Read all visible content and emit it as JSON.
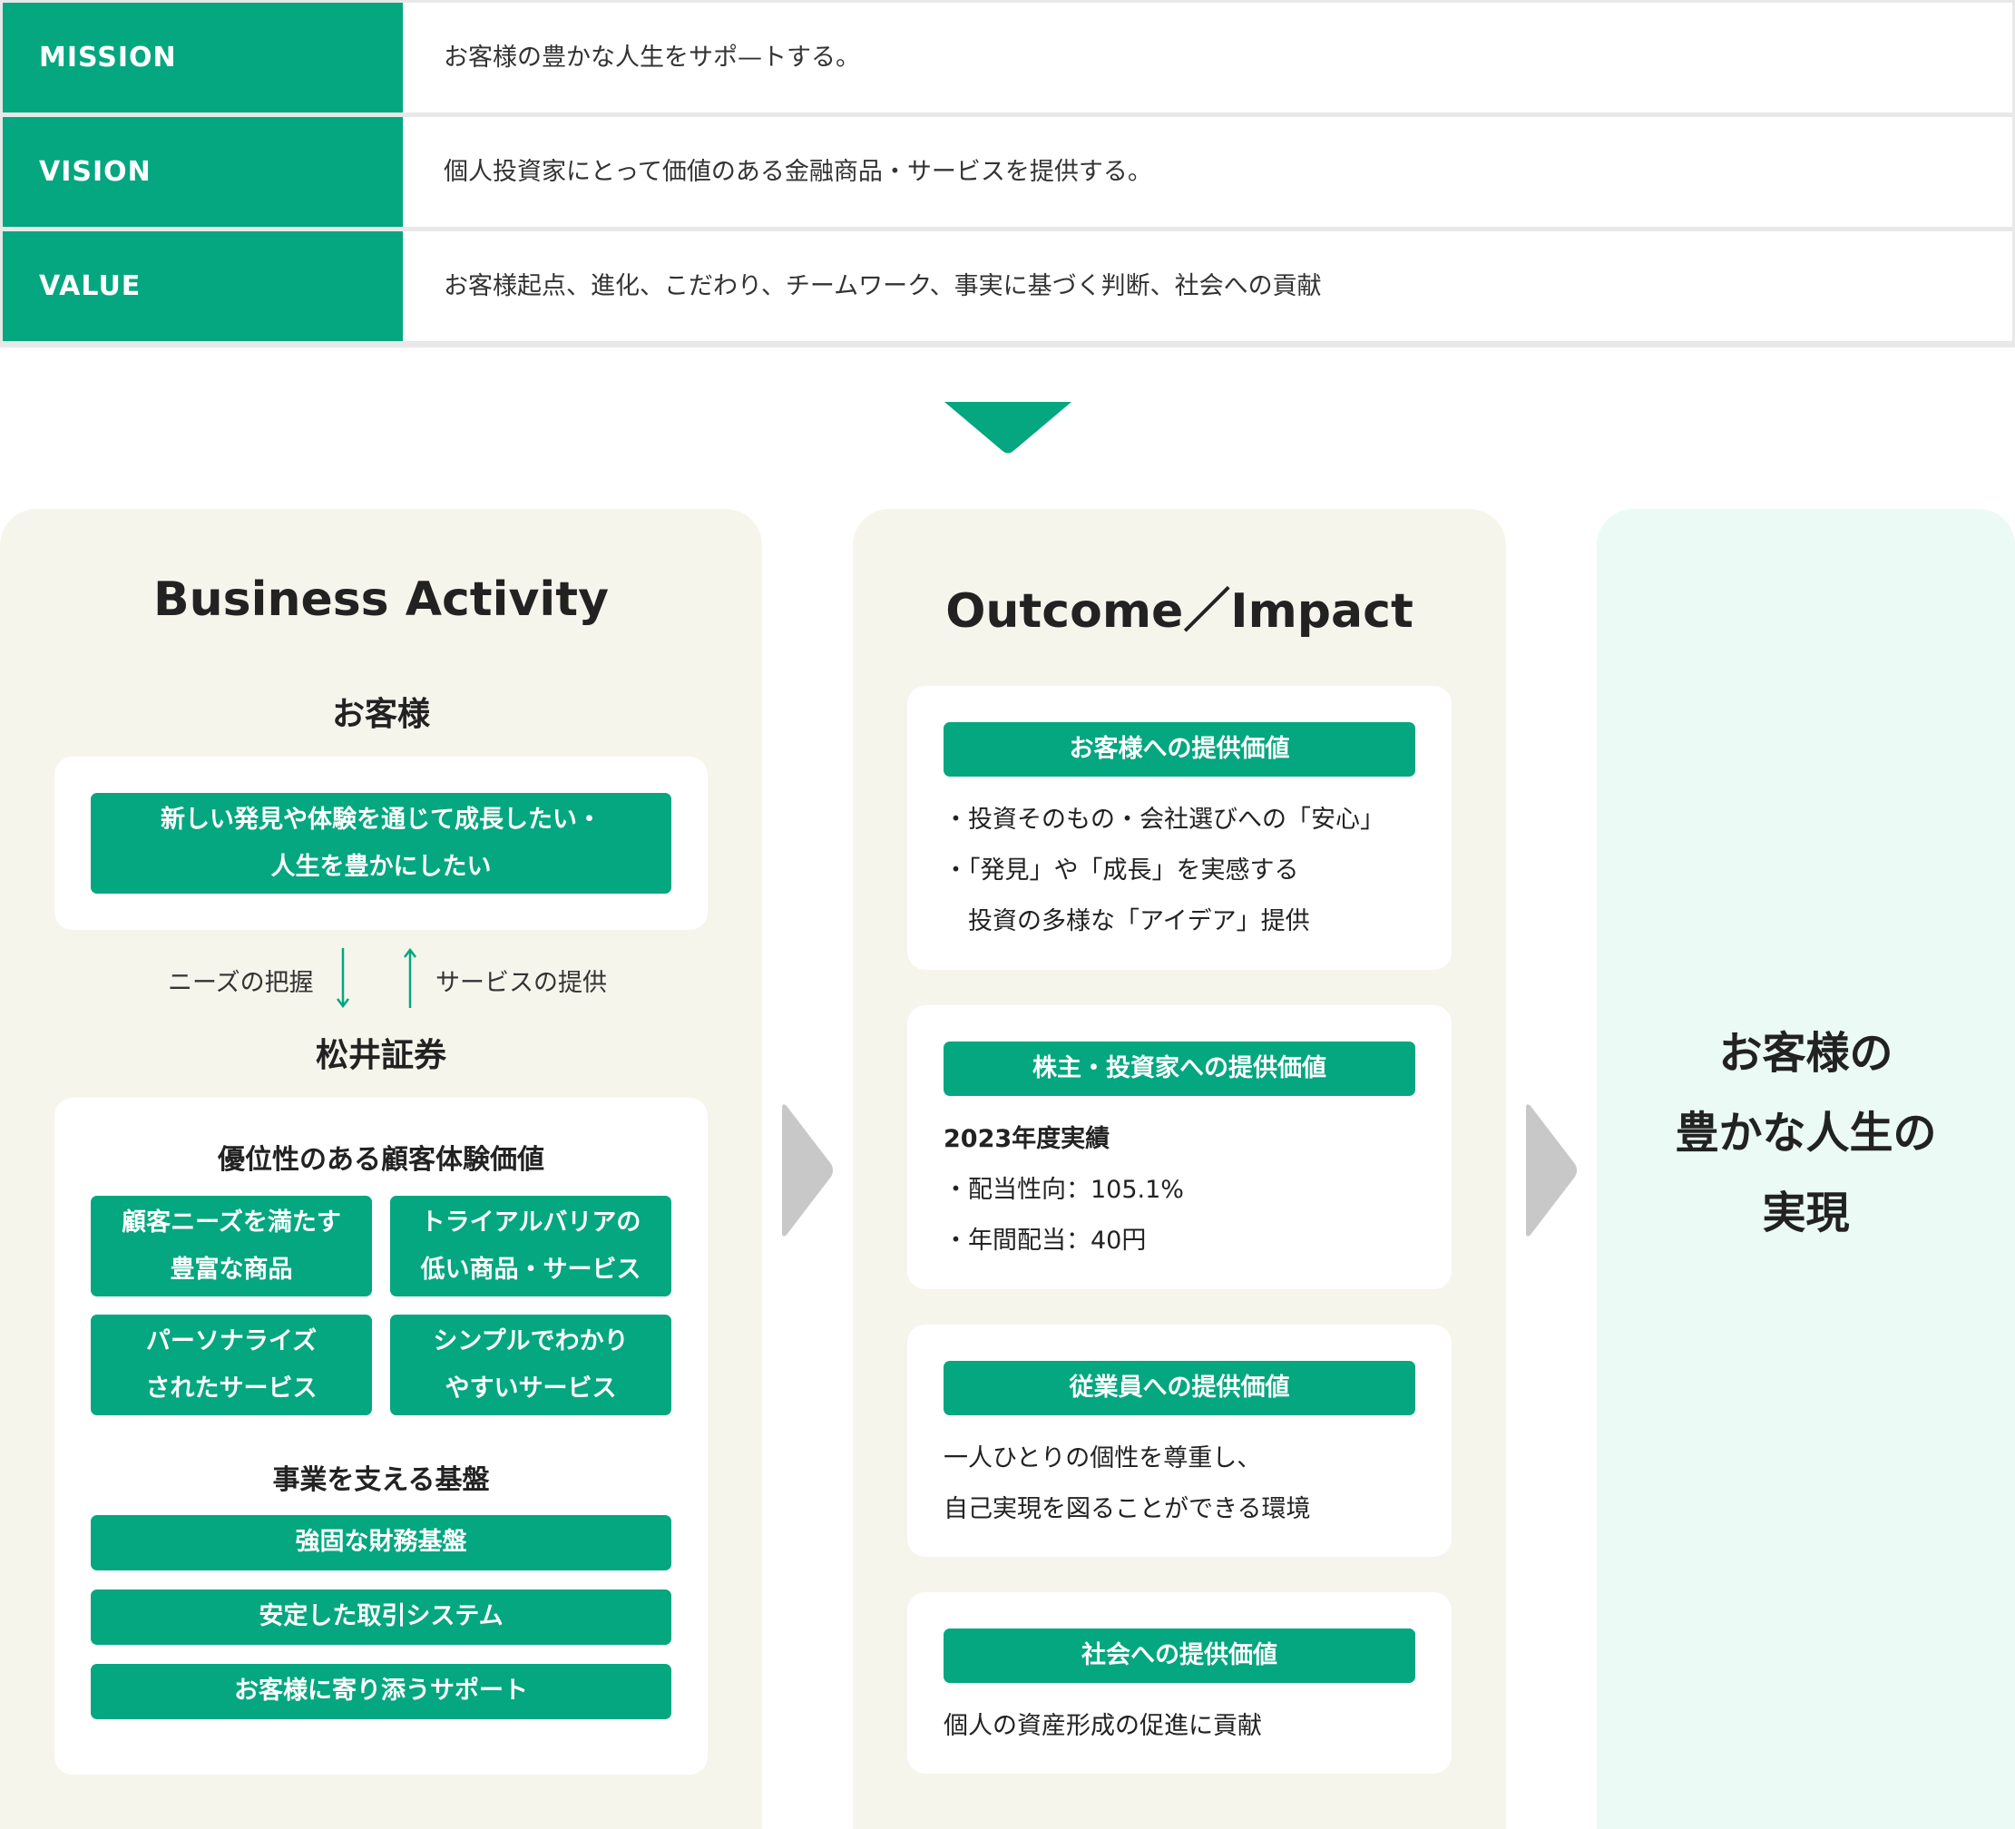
{
  "mvv": [
    {
      "label": "MISSION",
      "text": "お客様の豊かな人生をサポ—トする。"
    },
    {
      "label": "VISION",
      "text": "個人投資家にとって価値のある金融商品・サービスを提供する。"
    },
    {
      "label": "VALUE",
      "text": "お客様起点、進化、こだわり、チームワーク、事実に基づく判断、社会への貢献"
    }
  ],
  "business_activity": {
    "title": "Business Activity",
    "customer_title": "お客様",
    "customer_need": [
      "新しい発見や体験を通じて成長したい・",
      "人生を豊かにしたい"
    ],
    "flow_left": "ニーズの把握",
    "flow_right": "サービスの提供",
    "company_title": "松井証券",
    "experience_title": "優位性のある顧客体験価値",
    "experience_items": [
      [
        "顧客ニーズを満たす",
        "豊富な商品"
      ],
      [
        "トライアルバリアの",
        "低い商品・サービス"
      ],
      [
        "パーソナライズ",
        "されたサービス"
      ],
      [
        "シンプルでわかり",
        "やすいサービス"
      ]
    ],
    "foundation_title": "事業を支える基盤",
    "foundation_items": [
      "強固な財務基盤",
      "安定した取引システム",
      "お客様に寄り添うサポート"
    ]
  },
  "outcome_impact": {
    "title": "Outcome／Impact",
    "cards": [
      {
        "heading": "お客様への提供価値",
        "lines": [
          "・投資そのもの・会社選びへの「安心」",
          "・「発見」や「成長」を実感する",
          "　投資の多様な「アイデア」提供"
        ]
      },
      {
        "heading": "株主・投資家への提供価値",
        "lines": [
          "2023年度実績",
          "・配当性向：105.1%",
          "・年間配当：40円"
        ]
      },
      {
        "heading": "従業員への提供価値",
        "lines": [
          "一人ひとりの個性を尊重し、",
          "自己実現を図ることができる環境"
        ]
      },
      {
        "heading": "社会への提供価値",
        "lines": [
          "個人の資産形成の促進に貢献"
        ]
      }
    ]
  },
  "result": {
    "lines": [
      "お客様の",
      "豊かな人生の",
      "実現"
    ]
  },
  "colors": {
    "green": "#04a77f",
    "beige": "#f6f5ec",
    "mint": "#ebfaf4",
    "arrow_gray": "#c8c8c8"
  }
}
